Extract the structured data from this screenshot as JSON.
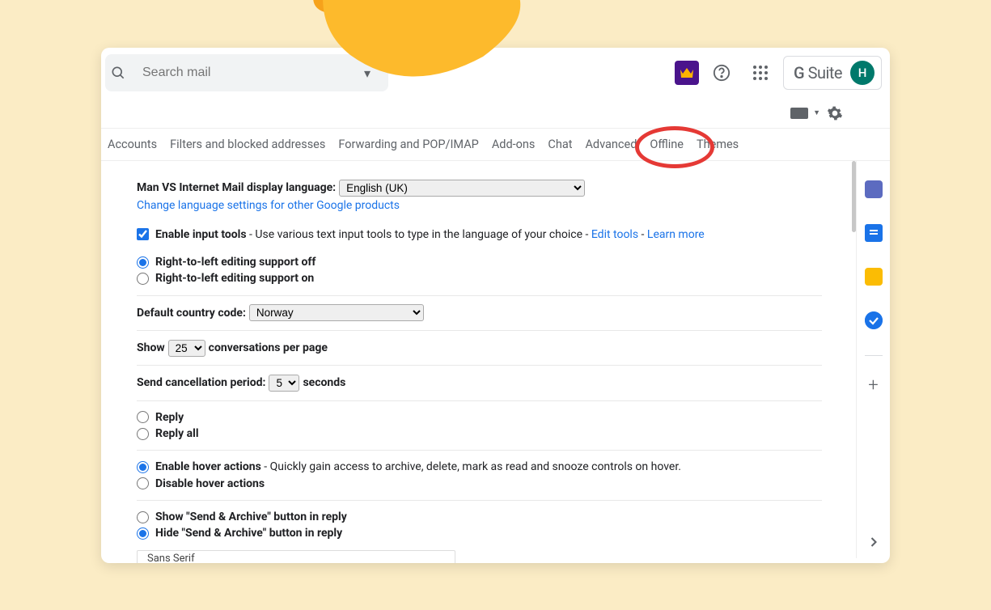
{
  "search": {
    "placeholder": "Search mail"
  },
  "suite": {
    "label_g": "G",
    "label_suite": "Suite",
    "avatar_initial": "H"
  },
  "tabs": {
    "accounts": "Accounts",
    "filters": "Filters and blocked addresses",
    "forwarding": "Forwarding and POP/IMAP",
    "addons": "Add-ons",
    "chat": "Chat",
    "advanced": "Advanced",
    "offline": "Offline",
    "themes": "Themes"
  },
  "settings": {
    "lang_label": "Man VS Internet Mail display language:",
    "lang_value": "English (UK)",
    "lang_change_link": "Change language settings for other Google products",
    "enable_input_tools": "Enable input tools",
    "enable_input_tools_desc": " - Use various text input tools to type in the language of your choice - ",
    "edit_tools": "Edit tools",
    "dash": " - ",
    "learn_more": "Learn more",
    "rtl_off": "Right-to-left editing support off",
    "rtl_on": "Right-to-left editing support on",
    "country_label": "Default country code:",
    "country_value": "Norway",
    "show": "Show",
    "page_size_value": "25",
    "conv_per_page": "conversations per page",
    "send_cancel_label": "Send cancellation period:",
    "send_cancel_value": "5",
    "seconds": "seconds",
    "reply": "Reply",
    "reply_all": "Reply all",
    "hover_enable": "Enable hover actions",
    "hover_enable_desc": " - Quickly gain access to archive, delete, mark as read and snooze controls on hover.",
    "hover_disable": "Disable hover actions",
    "send_archive_show": "Show \"Send & Archive\" button in reply",
    "send_archive_hide": "Hide \"Send & Archive\" button in reply"
  },
  "bottom": {
    "font": "Sans Serif"
  }
}
